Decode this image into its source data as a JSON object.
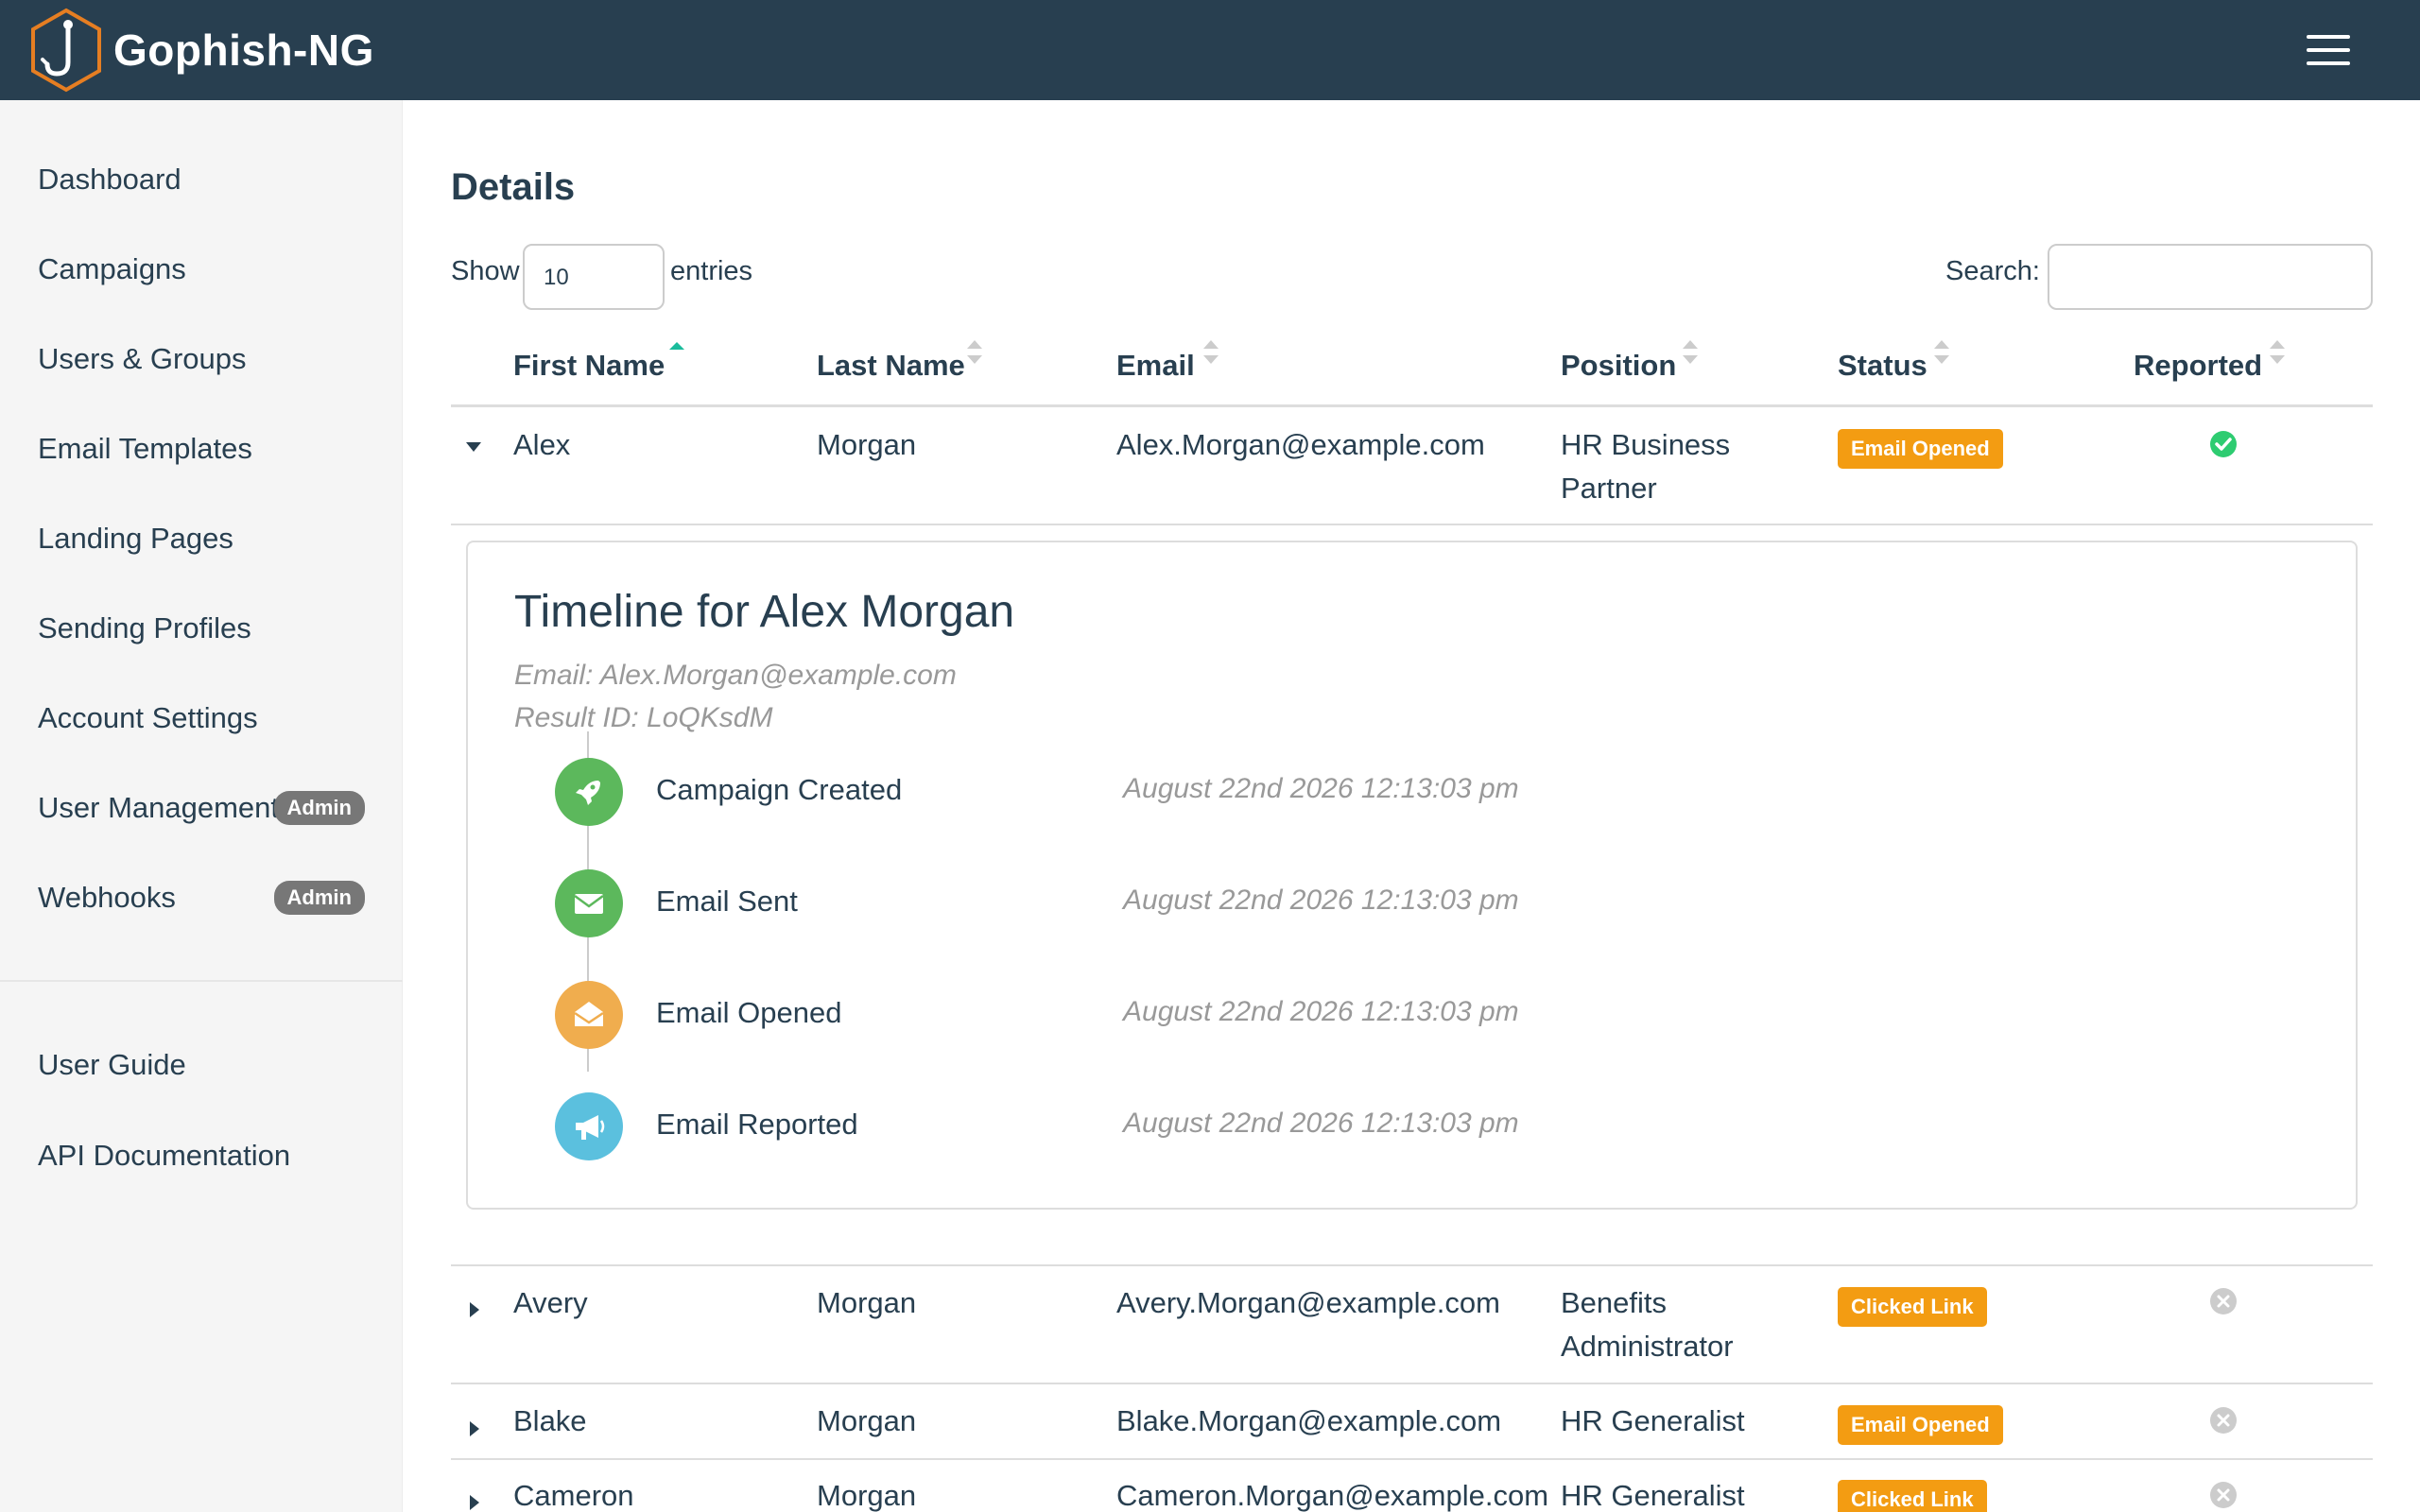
{
  "app": {
    "brand_name": "Gophish-NG"
  },
  "sidebar": {
    "items": [
      {
        "label": "Dashboard"
      },
      {
        "label": "Campaigns"
      },
      {
        "label": "Users & Groups"
      },
      {
        "label": "Email Templates"
      },
      {
        "label": "Landing Pages"
      },
      {
        "label": "Sending Profiles"
      },
      {
        "label": "Account Settings"
      },
      {
        "label": "User Management",
        "badge": "Admin"
      },
      {
        "label": "Webhooks",
        "badge": "Admin"
      }
    ],
    "footer_items": [
      {
        "label": "User Guide"
      },
      {
        "label": "API Documentation"
      }
    ]
  },
  "main": {
    "title": "Details",
    "length": {
      "show_label": "Show",
      "value": "10",
      "entries_label": "entries"
    },
    "search": {
      "label": "Search:",
      "value": ""
    },
    "columns": [
      "First Name",
      "Last Name",
      "Email",
      "Position",
      "Status",
      "Reported"
    ],
    "rows": [
      {
        "first": "Alex",
        "last": "Morgan",
        "email": "Alex.Morgan@example.com",
        "position_line1": "HR Business",
        "position_line2": "Partner",
        "status": "Email Opened",
        "reported": true,
        "expanded": true
      },
      {
        "first": "Avery",
        "last": "Morgan",
        "email": "Avery.Morgan@example.com",
        "position_line1": "Benefits",
        "position_line2": "Administrator",
        "status": "Clicked Link",
        "reported": false,
        "expanded": false
      },
      {
        "first": "Blake",
        "last": "Morgan",
        "email": "Blake.Morgan@example.com",
        "position_line1": "HR Generalist",
        "position_line2": "",
        "status": "Email Opened",
        "reported": false,
        "expanded": false
      },
      {
        "first": "Cameron",
        "last": "Morgan",
        "email": "Cameron.Morgan@example.com",
        "position_line1": "HR Generalist",
        "position_line2": "",
        "status": "Clicked Link",
        "reported": false,
        "expanded": false
      }
    ]
  },
  "timeline": {
    "title": "Timeline for Alex Morgan",
    "email_line": "Email: Alex.Morgan@example.com",
    "result_line": "Result ID: LoQKsdM",
    "events": [
      {
        "label": "Campaign Created",
        "date": "August 22nd 2026 12:13:03 pm",
        "icon": "rocket-icon",
        "color": "#5cb85c"
      },
      {
        "label": "Email Sent",
        "date": "August 22nd 2026 12:13:03 pm",
        "icon": "envelope-icon",
        "color": "#5cb85c"
      },
      {
        "label": "Email Opened",
        "date": "August 22nd 2026 12:13:03 pm",
        "icon": "envelope-open-icon",
        "color": "#f0ad4e"
      },
      {
        "label": "Email Reported",
        "date": "August 22nd 2026 12:13:03 pm",
        "icon": "bullhorn-icon",
        "color": "#5bc0de"
      }
    ]
  },
  "colors": {
    "navbar": "#283f50",
    "status_orange": "#f39c12",
    "success_green": "#5cb85c",
    "warning_orange": "#f0ad4e",
    "info_blue": "#5bc0de",
    "sort_active": "#1abc9c"
  }
}
